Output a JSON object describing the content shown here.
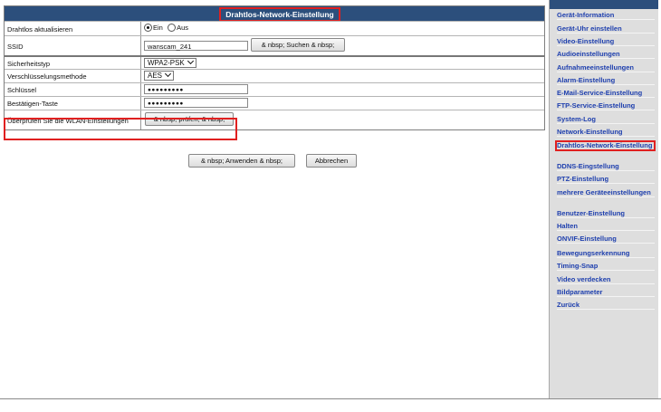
{
  "form": {
    "title": "Drahtlos-Network-Einstellung",
    "rows": {
      "wifi_enabled": {
        "label": "Drahtlos aktualisieren",
        "on_label": "Ein",
        "off_label": "Aus",
        "selected": "Ein"
      },
      "ssid": {
        "label": "SSID",
        "value": "wanscam_241",
        "button": "& nbsp; Suchen & nbsp;"
      },
      "security": {
        "label": "Sicherheitstyp",
        "value": "WPA2-PSK"
      },
      "encryption": {
        "label": "Verschlüsselungsmethode",
        "value": "AES"
      },
      "key": {
        "label": "Schlüssel",
        "value": "●●●●●●●●●"
      },
      "confirm": {
        "label": "Bestätigen-Taste",
        "value": "●●●●●●●●●"
      },
      "check": {
        "label": "Überprüfen Sie die WLAN-Einstellungen",
        "button": "& nbsp; prüfen, & nbsp;"
      }
    },
    "apply_label": "& nbsp; Anwenden & nbsp;",
    "cancel_label": "Abbrechen"
  },
  "sidebar": {
    "items": [
      {
        "label": "Gerät-Information"
      },
      {
        "label": "Gerät-Uhr einstellen"
      },
      {
        "label": "Video-Einstellung"
      },
      {
        "label": "Audioeinstellungen"
      },
      {
        "label": "Aufnahmeeinstellungen"
      },
      {
        "label": "Alarm-Einstellung"
      },
      {
        "label": "E-Mail-Service-Einstellung"
      },
      {
        "label": "FTP-Service-Einstellung"
      },
      {
        "label": "System-Log"
      },
      {
        "label": "Network-Einstellung"
      },
      {
        "label": "Drahtlos-Network-Einstellung",
        "active": true
      },
      {
        "label": "DDNS-Eingstellung"
      },
      {
        "label": "PTZ-Einstellung"
      },
      {
        "label": "mehrere Geräteeinstellungen"
      },
      {
        "label": "Benutzer-Einstellung"
      },
      {
        "label": "Halten"
      },
      {
        "label": "ONVIF-Einstellung"
      },
      {
        "label": "Bewegungserkennung"
      },
      {
        "label": "Timing-Snap"
      },
      {
        "label": "Video verdecken"
      },
      {
        "label": "Bildparameter"
      },
      {
        "label": "Zurück"
      }
    ]
  },
  "colors": {
    "header_bg": "#2c4f7c",
    "link": "#1e3fae",
    "highlight": "#e02020",
    "sidebar_bg": "#dedede"
  }
}
